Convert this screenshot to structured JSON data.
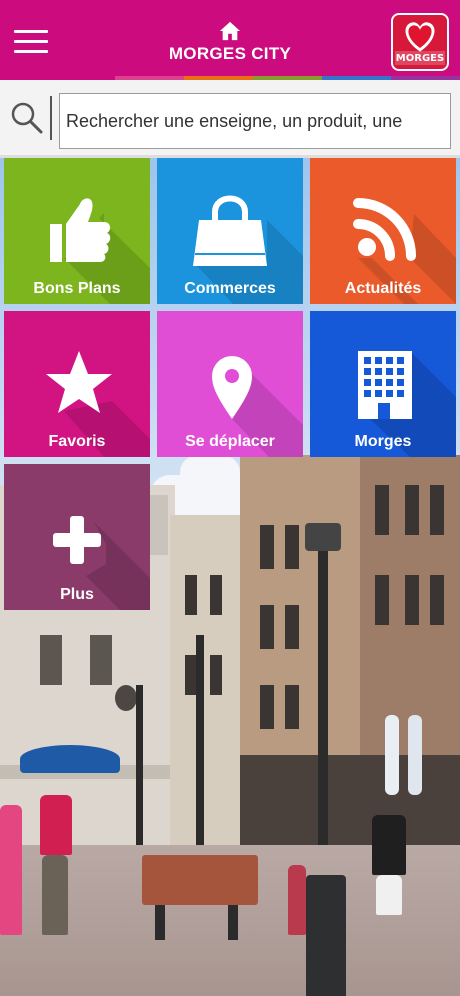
{
  "header": {
    "title": "MORGES CITY",
    "logo_text": "MORGES",
    "color": "#cc0b7e"
  },
  "search": {
    "placeholder": "Rechercher une enseigne, un produit, une"
  },
  "tiles": [
    {
      "label": "Bons Plans",
      "icon": "thumbs-up-icon",
      "color": "#7cb51d"
    },
    {
      "label": "Commerces",
      "icon": "shopping-bag-icon",
      "color": "#1b93dd"
    },
    {
      "label": "Actualités",
      "icon": "rss-feed-icon",
      "color": "#ea5a2b"
    },
    {
      "label": "Favoris",
      "icon": "star-icon",
      "color": "#d21483"
    },
    {
      "label": "Se déplacer",
      "icon": "map-pin-icon",
      "color": "#e04ed6"
    },
    {
      "label": "Morges",
      "icon": "building-icon",
      "color": "#1558d8"
    },
    {
      "label": "Plus",
      "icon": "plus-icon",
      "color": "#8a3b6a"
    }
  ]
}
